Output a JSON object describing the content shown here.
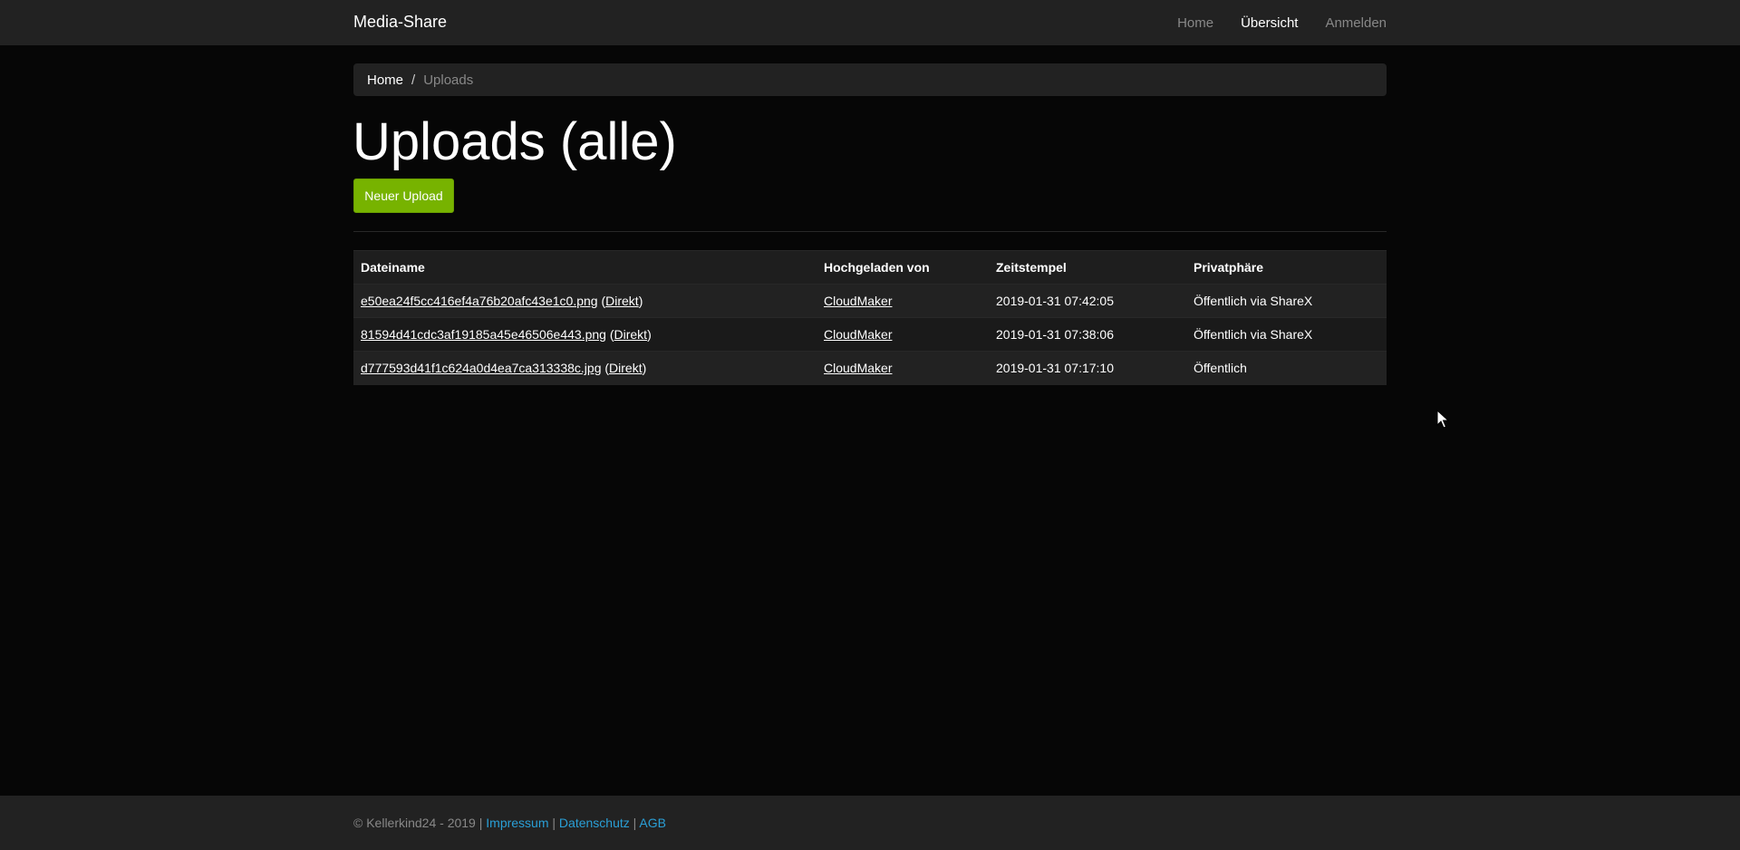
{
  "navbar": {
    "brand": "Media-Share",
    "links": [
      {
        "label": "Home",
        "active": false
      },
      {
        "label": "Übersicht",
        "active": true
      },
      {
        "label": "Anmelden",
        "active": false
      }
    ]
  },
  "breadcrumb": {
    "home": "Home",
    "separator": "/",
    "current": "Uploads"
  },
  "main": {
    "title": "Uploads (alle)",
    "new_upload_label": "Neuer Upload"
  },
  "table": {
    "headers": [
      "Dateiname",
      "Hochgeladen von",
      "Zeitstempel",
      "Privatphäre"
    ],
    "rows": [
      {
        "filename": "e50ea24f5cc416ef4a76b20afc43e1c0.png",
        "direct": "Direkt",
        "uploader": "CloudMaker",
        "timestamp": "2019-01-31 07:42:05",
        "privacy": "Öffentlich via ShareX"
      },
      {
        "filename": "81594d41cdc3af19185a45e46506e443.png",
        "direct": "Direkt",
        "uploader": "CloudMaker",
        "timestamp": "2019-01-31 07:38:06",
        "privacy": "Öffentlich via ShareX"
      },
      {
        "filename": "d777593d41f1c624a0d4ea7ca313338c.jpg",
        "direct": "Direkt",
        "uploader": "CloudMaker",
        "timestamp": "2019-01-31 07:17:10",
        "privacy": "Öffentlich"
      }
    ]
  },
  "footer": {
    "copyright": "© Kellerkind24 - 2019 |",
    "sep": "|",
    "impressum": "Impressum",
    "datenschutz": "Datenschutz",
    "agb": "AGB"
  },
  "colors": {
    "accent_green": "#77b300",
    "link_blue": "#2a9fd6",
    "background": "#060606",
    "panel": "#222222"
  },
  "icons": {
    "cursor": "mouse-pointer-icon"
  }
}
